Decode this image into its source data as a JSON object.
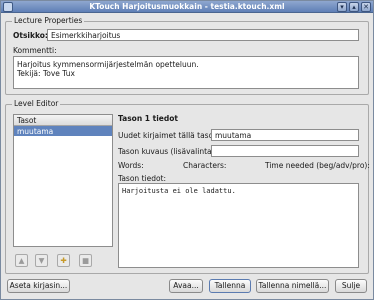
{
  "window": {
    "title": "KTouch Harjoitusmuokkain - testia.ktouch.xml",
    "minimize": "▾",
    "maximize": "▴",
    "close": "✕"
  },
  "lecture": {
    "group_title": "Lecture Properties",
    "title_label": "Otsikko:",
    "title_value": "Esimerkkiharjoitus",
    "comment_label": "Kommentti:",
    "comment_value": "Harjoitus kymmensormijärjestelmän opetteluun.\nTekijä: Tove Tux"
  },
  "level_editor": {
    "group_title": "Level Editor",
    "list_header": "Tasot",
    "levels": [
      "muutama"
    ],
    "level_title": "Tason 1 tiedot",
    "new_chars_label": "Uudet kirjaimet tällä tasolla",
    "new_chars_value": "muutama",
    "desc_label": "Tason kuvaus (lisävalinta):",
    "desc_value": "",
    "words_label": "Words:",
    "characters_label": "Characters:",
    "time_label": "Time needed (beg/adv/pro):",
    "details_label": "Tason tiedot:",
    "details_value": "Harjoitusta ei ole ladattu.",
    "icon_buttons": [
      "arrow-up-icon",
      "arrow-down-icon",
      "new-level-icon",
      "delete-level-icon"
    ]
  },
  "buttons": {
    "set_font": "Aseta kirjasin...",
    "open": "Avaa...",
    "save": "Tallenna",
    "save_as": "Tallenna nimellä...",
    "close": "Sulje"
  },
  "colors": {
    "titlebar": "#6f8ec4",
    "selection": "#5f83bd"
  }
}
